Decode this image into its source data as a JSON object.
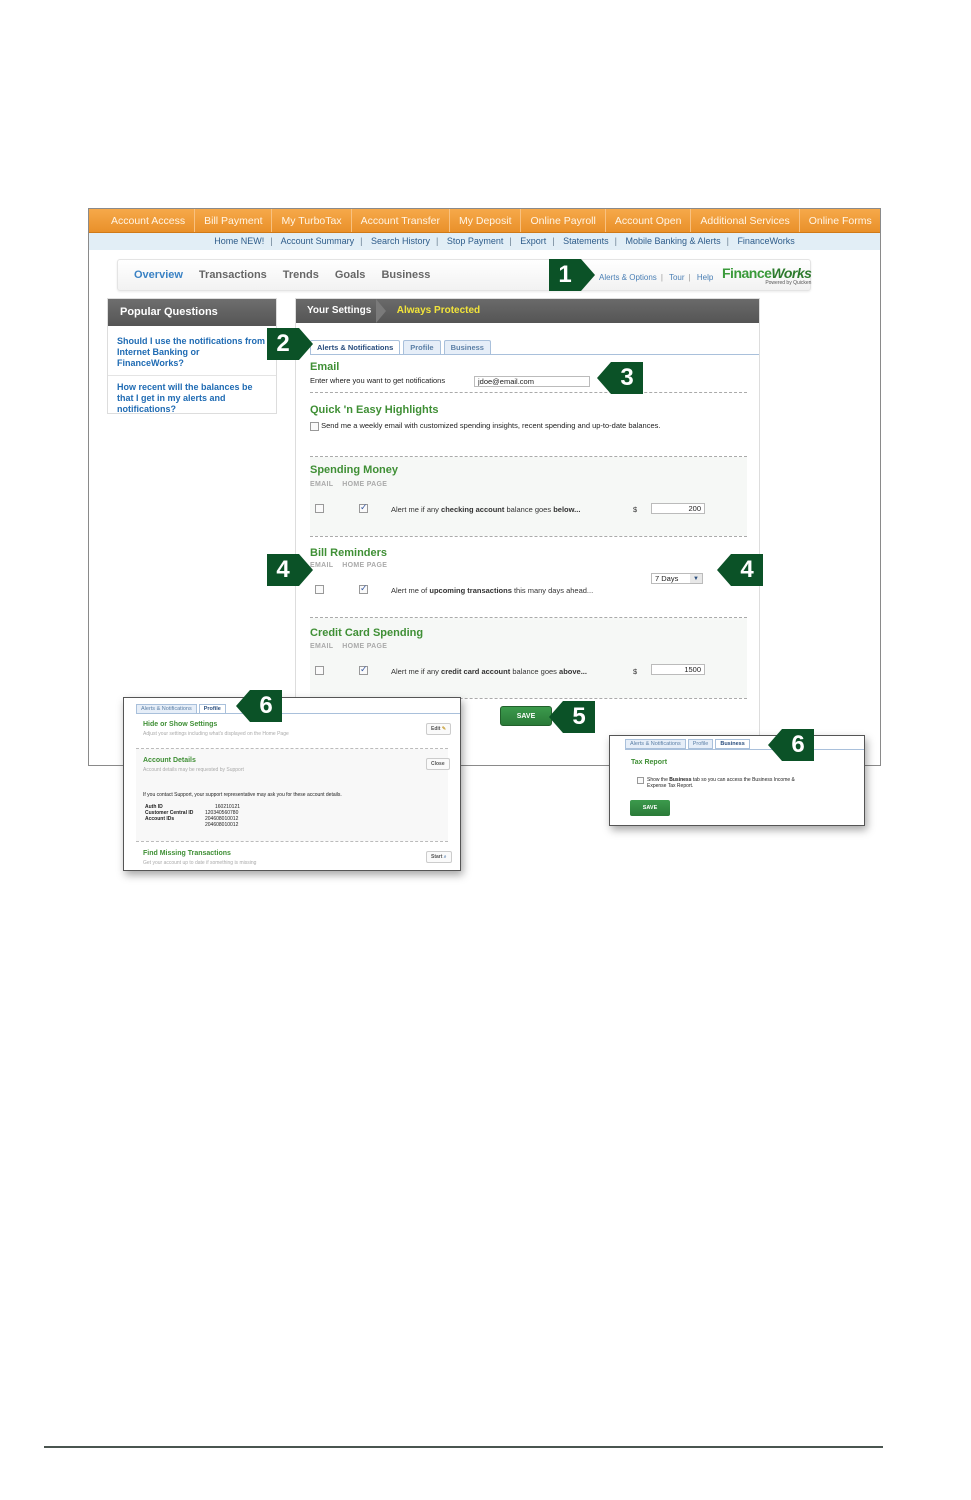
{
  "top_nav": [
    "Account Access",
    "Bill Payment",
    "My TurboTax",
    "Account Transfer",
    "My Deposit",
    "Online Payroll",
    "Account Open",
    "Additional Services",
    "Online Forms"
  ],
  "sub_nav": [
    "Home NEW!",
    "Account Summary",
    "Search History",
    "Stop Payment",
    "Export",
    "Statements",
    "Mobile Banking & Alerts",
    "FinanceWorks"
  ],
  "main_tabs": [
    "Overview",
    "Transactions",
    "Trends",
    "Goals",
    "Business"
  ],
  "util_links": [
    "Alerts & Options",
    "Tour",
    "Help"
  ],
  "logo": {
    "name_a": "Finance",
    "name_b": "Works",
    "powered": "Powered by Quicken"
  },
  "popular_questions": {
    "title": "Popular Questions",
    "items": [
      "Should I use the notifications from Internet Banking or FinanceWorks?",
      "How recent will the balances be that I get in my alerts and notifications?"
    ]
  },
  "settings": {
    "breadcrumb": [
      "Your Settings",
      "Always Protected"
    ],
    "tabs": [
      "Alerts & Notifications",
      "Profile",
      "Business"
    ],
    "email": {
      "title": "Email",
      "label": "Enter where you want to get notifications",
      "value": "jdoe@email.com"
    },
    "highlights": {
      "title": "Quick 'n Easy Highlights",
      "label": "Send me a weekly email with customized spending insights, recent spending and up-to-date balances.",
      "checked": false
    },
    "col_email": "EMAIL",
    "col_home": "HOME PAGE",
    "currency": "$",
    "spending": {
      "title": "Spending Money",
      "pre": "Alert me if any ",
      "b1": "checking account",
      "mid": " balance goes ",
      "b2": "below...",
      "value": "200",
      "email": false,
      "home": true
    },
    "bills": {
      "title": "Bill Reminders",
      "pre": "Alert me of ",
      "b1": "upcoming transactions",
      "mid": " this many days ahead...",
      "select": "7 Days",
      "email": false,
      "home": true
    },
    "credit": {
      "title": "Credit Card Spending",
      "pre": "Alert me if any ",
      "b1": "credit card account",
      "mid": " balance goes ",
      "b2": "above...",
      "value": "1500",
      "email": false,
      "home": true
    },
    "save": "SAVE"
  },
  "profile_panel": {
    "tabs": [
      "Alerts & Notifications",
      "Profile"
    ],
    "hide_show": {
      "title": "Hide or Show Settings",
      "desc": "Adjust your settings including what's displayed on the Home Page",
      "button": "Edit"
    },
    "account_details": {
      "title": "Account Details",
      "desc": "Account details may be requested by Support",
      "button": "Close",
      "note": "If you contact Support, your support representative may ask you for these account details.",
      "auth_id_label": "Auth ID",
      "auth_id": "160210121",
      "cc_id_label": "Customer Central ID",
      "cc_id": "120340560780",
      "account_ids_label": "Account IDs",
      "account_ids": [
        "204608010012",
        "204608010012"
      ]
    },
    "find_missing": {
      "title": "Find Missing Transactions",
      "desc": "Get your account up to date if something is missing",
      "button": "Start"
    }
  },
  "business_panel": {
    "tabs": [
      "Alerts & Notifications",
      "Profile",
      "Business"
    ],
    "title": "Tax Report",
    "pre": "Show the ",
    "bold": "Business",
    "post": " tab so you can access the Business Income & Expense Tax Report.",
    "save": "SAVE"
  },
  "callouts": [
    "1",
    "2",
    "3",
    "4",
    "4",
    "5",
    "6",
    "6"
  ]
}
